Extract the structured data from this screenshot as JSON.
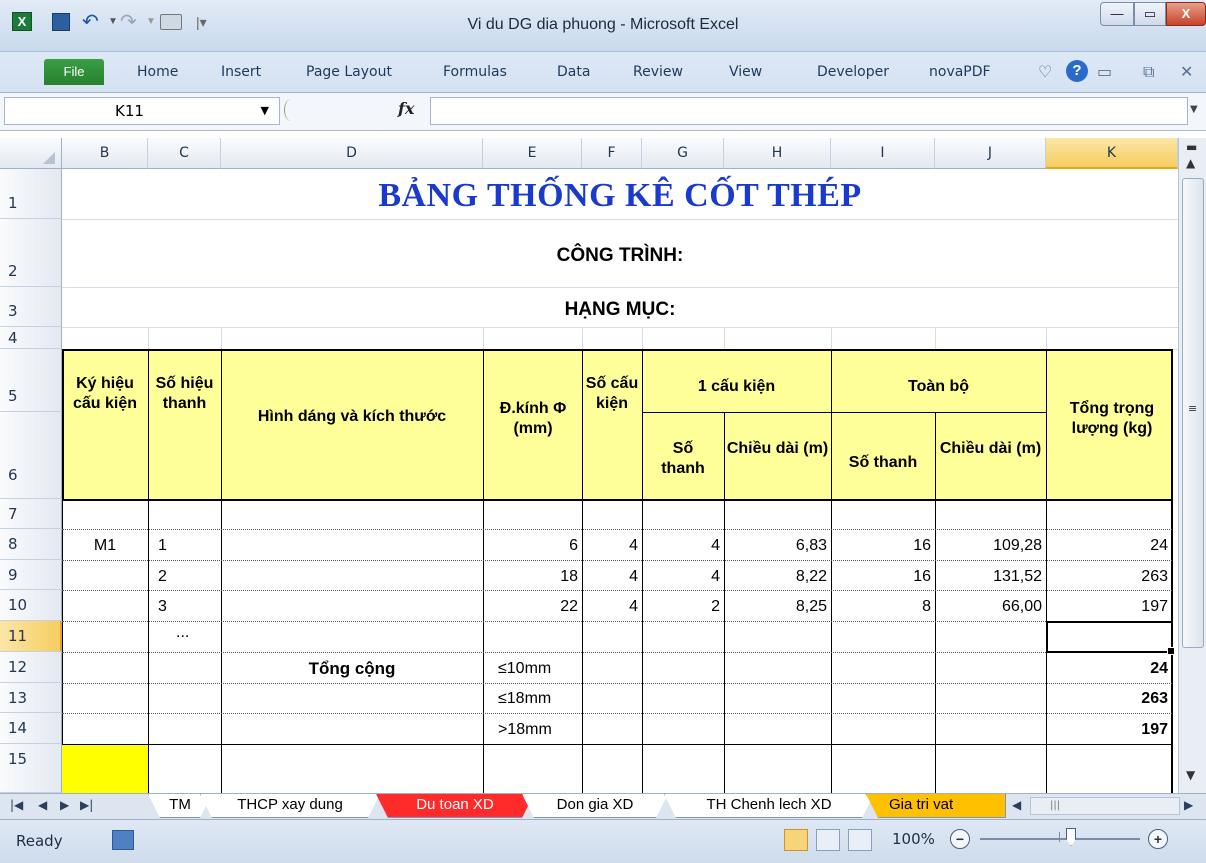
{
  "window": {
    "title": "Vi du DG dia phuong  -  Microsoft Excel",
    "app_icon": "X",
    "min": "—",
    "max": "▭",
    "close": "X"
  },
  "ribbon": {
    "file": "File",
    "tabs": [
      "Home",
      "Insert",
      "Page Layout",
      "Formulas",
      "Data",
      "Review",
      "View",
      "Developer",
      "novaPDF"
    ]
  },
  "formula_bar": {
    "name_box": "K11",
    "fx": "fx",
    "content": ""
  },
  "columns": [
    "B",
    "C",
    "D",
    "E",
    "F",
    "G",
    "H",
    "I",
    "J",
    "K"
  ],
  "rows": [
    "1",
    "2",
    "3",
    "4",
    "5",
    "6",
    "7",
    "8",
    "9",
    "10",
    "11",
    "12",
    "13",
    "14",
    "15"
  ],
  "sheet": {
    "title": "BẢNG THỐNG KÊ CỐT THÉP",
    "cong_trinh": "CÔNG TRÌNH:",
    "hang_muc": "HẠNG MỤC:",
    "headers": {
      "ky_hieu": "Ký hiệu cấu kiện",
      "so_hieu": "Số hiệu thanh",
      "hinh_dang": "Hình dáng và kích thước",
      "duong_kinh": "Đ.kính Φ (mm)",
      "so_cau_kien": "Số cấu kiện",
      "mot_cau_kien": "1 cấu kiện",
      "toan_bo": "Toàn bộ",
      "so_thanh_1": "Số thanh",
      "chieu_dai_1": "Chiều dài (m)",
      "so_thanh_2": "Số thanh",
      "chieu_dai_2": "Chiều dài (m)",
      "tong_trong_luong": "Tổng trọng lượng (kg)"
    },
    "data_rows": [
      {
        "B": "M1",
        "C": "1",
        "E": "6",
        "F": "4",
        "G": "4",
        "H": "6,83",
        "I": "16",
        "J": "109,28",
        "K": "24"
      },
      {
        "B": "",
        "C": "2",
        "E": "18",
        "F": "4",
        "G": "4",
        "H": "8,22",
        "I": "16",
        "J": "131,52",
        "K": "263"
      },
      {
        "B": "",
        "C": "3",
        "E": "22",
        "F": "4",
        "G": "2",
        "H": "8,25",
        "I": "8",
        "J": "66,00",
        "K": "197"
      }
    ],
    "ellipsis": "...",
    "total_label": "Tổng cộng",
    "totals": [
      {
        "E": "≤10mm",
        "K": "24"
      },
      {
        "E": "≤18mm",
        "K": "263"
      },
      {
        "E": ">18mm",
        "K": "197"
      }
    ]
  },
  "sheet_tabs": [
    {
      "name": "TM",
      "bg": "#ffffff",
      "fg": "#000000"
    },
    {
      "name": "THCP xay dung",
      "bg": "#ffffff",
      "fg": "#000000"
    },
    {
      "name": "Du toan XD",
      "bg": "#ff2a2a",
      "fg": "#ffffff"
    },
    {
      "name": "Don gia XD",
      "bg": "#ffffff",
      "fg": "#000000"
    },
    {
      "name": "TH Chenh lech XD",
      "bg": "#ffffff",
      "fg": "#000000"
    },
    {
      "name": "Gia tri vat",
      "bg": "#ffc000",
      "fg": "#000000"
    }
  ],
  "status": {
    "ready": "Ready",
    "zoom": "100%",
    "zoom_out": "−",
    "zoom_in": "+"
  },
  "colors": {
    "title": "#1a3acf",
    "header_fill": "#ffff99",
    "selected_header": "#f6ce60"
  }
}
